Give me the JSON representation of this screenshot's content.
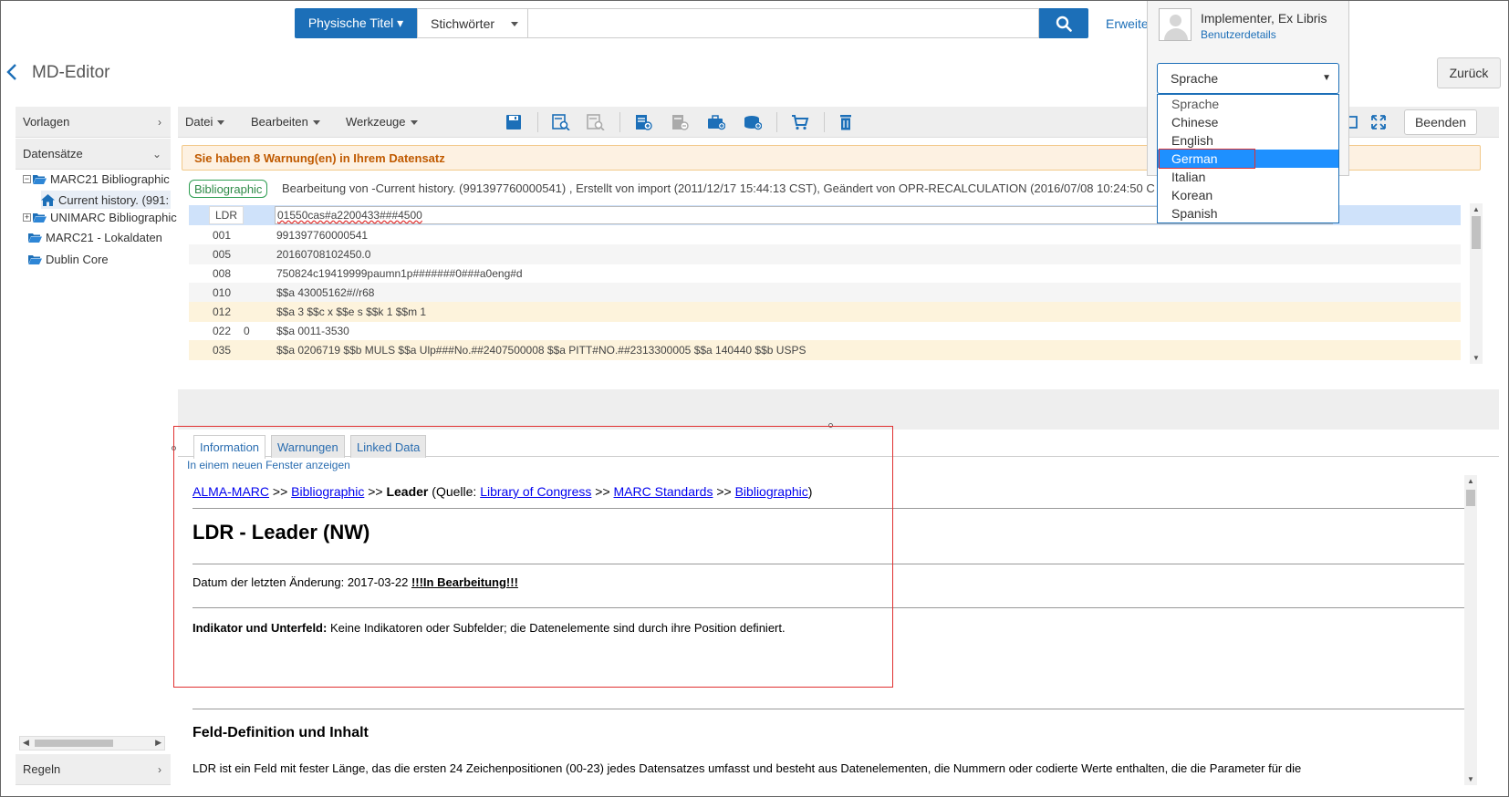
{
  "search": {
    "scope_label": "Physische Titel ▾",
    "type_label": "Stichwörter",
    "input_value": "",
    "advanced_link": "Erweite"
  },
  "user": {
    "name": "Implementer, Ex Libris",
    "details_link": "Benutzerdetails",
    "language_select_value": "Sprache",
    "language_options": [
      "Sprache",
      "Chinese",
      "English",
      "German",
      "Italian",
      "Korean",
      "Spanish"
    ],
    "language_selected": "German"
  },
  "page": {
    "title": "MD-Editor",
    "back_button": "Zurück"
  },
  "left_panel": {
    "templates_label": "Vorlagen",
    "records_label": "Datensätze",
    "rules_label": "Regeln",
    "tree": [
      {
        "label": "MARC21 Bibliographic",
        "expand": "−"
      },
      {
        "label": "Current history. (991:"
      },
      {
        "label": "UNIMARC Bibliographic",
        "expand": "+"
      },
      {
        "label": "MARC21 - Lokaldaten"
      },
      {
        "label": "Dublin Core"
      }
    ]
  },
  "toolbar": {
    "menu_file": "Datei",
    "menu_edit": "Bearbeiten",
    "menu_tools": "Werkzeuge",
    "finish_button": "Beenden"
  },
  "warning": "Sie haben 8 Warnung(en) in Ihrem Datensatz",
  "record": {
    "badge": "Bibliographic",
    "meta": "Bearbeitung von -Current history. (991397760000541) , Erstellt von import (2011/12/17 15:44:13 CST), Geändert von OPR-RECALCULATION (2016/07/08 10:24:50 C",
    "ldr_tag": "LDR",
    "ldr_value": "01550cas#a2200433###4500",
    "fields": [
      {
        "tag": "001",
        "ind": "",
        "value": "991397760000541"
      },
      {
        "tag": "005",
        "ind": "",
        "value": "20160708102450.0"
      },
      {
        "tag": "008",
        "ind": "",
        "value": "750824c19419999paumn1p#######0###a0eng#d"
      },
      {
        "tag": "010",
        "ind": "",
        "value": "$$a 43005162#//r68"
      },
      {
        "tag": "012",
        "ind": "",
        "value": "$$a 3 $$c x $$e s $$k 1 $$m 1"
      },
      {
        "tag": "022",
        "ind": "0",
        "value": "$$a 0011-3530"
      },
      {
        "tag": "035",
        "ind": "",
        "value": "$$a 0206719 $$b MULS $$a Ulp###No.##2407500008 $$a PITT#NO.##2313300005 $$a 140440 $$b USPS"
      }
    ]
  },
  "bottom": {
    "tabs": [
      "Information",
      "Warnungen",
      "Linked Data"
    ],
    "new_window_link": "In einem neuen Fenster anzeigen",
    "crumb": {
      "alma_marc": "ALMA-MARC",
      "sep1": " >> ",
      "bibliographic": "Bibliographic",
      "sep2": " >> ",
      "leader": "Leader",
      "source_prefix": " (Quelle: ",
      "loc": "Library of Congress",
      "sep3": " >> ",
      "marc_standards": "MARC Standards",
      "sep4": " >> ",
      "bibliographic2": "Bibliographic",
      "close": ")"
    },
    "heading": "LDR - Leader (NW)",
    "date_label": "Datum der letzten Änderung: 2017-03-22 ",
    "date_status": "!!!In Bearbeitung!!!",
    "indicator_label": "Indikator und Unterfeld:",
    "indicator_text": " Keine Indikatoren oder Subfelder; die Datenelemente sind durch ihre Position definiert.",
    "section_heading": "Feld-Definition und Inhalt",
    "section_text": "LDR ist ein Feld mit fester Länge, das die ersten 24 Zeichenpositionen (00-23) jedes Datensatzes umfasst und besteht aus Datenelementen, die Nummern oder codierte Werte enthalten, die die Parameter für die"
  },
  "colors": {
    "primary": "#1c6fb8",
    "highlight_red": "#e03030",
    "warning_text": "#c05a00",
    "badge_green": "#2e9e52"
  }
}
